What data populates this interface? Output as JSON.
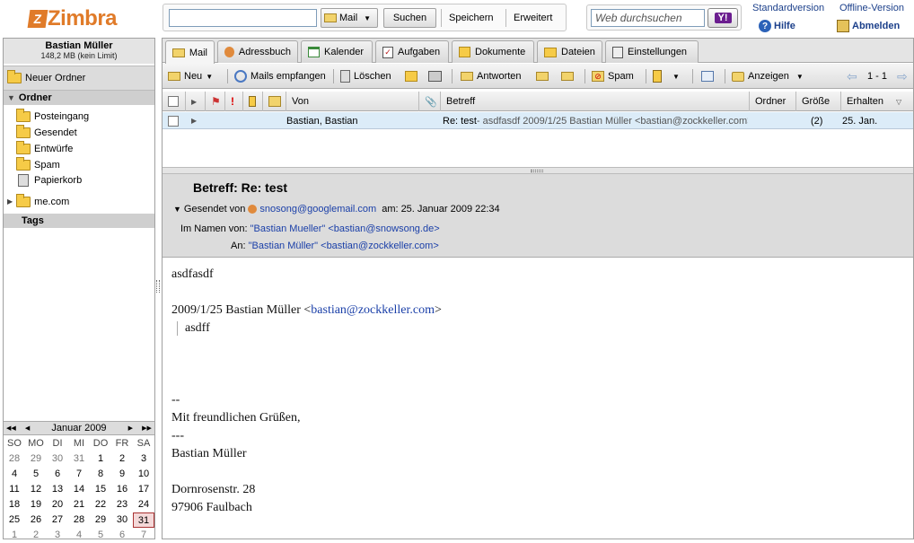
{
  "header": {
    "logo_text": "Zimbra",
    "logo_mark": "Z",
    "search_value": "",
    "search_scope": "Mail",
    "search_btn": "Suchen",
    "save_btn": "Speichern",
    "advanced_btn": "Erweitert",
    "web_search_placeholder": "Web durchsuchen",
    "yahoo_label": "Y!",
    "standard_version": "Standardversion",
    "offline_version": "Offline-Version",
    "help": "Hilfe",
    "logout": "Abmelden"
  },
  "sidebar": {
    "user_name": "Bastian Müller",
    "quota": "148,2 MB (kein Limit)",
    "new_folder": "Neuer Ordner",
    "folders_header": "Ordner",
    "folders": [
      {
        "label": "Posteingang"
      },
      {
        "label": "Gesendet"
      },
      {
        "label": "Entwürfe"
      },
      {
        "label": "Spam"
      },
      {
        "label": "Papierkorb"
      },
      {
        "label": "me.com"
      }
    ],
    "tags_header": "Tags"
  },
  "calendar": {
    "month": "Januar 2009",
    "nav_prev_year": "◀◀",
    "nav_prev": "◀",
    "nav_next": "▶",
    "nav_next_year": "▶▶",
    "weekdays": [
      "SO",
      "MO",
      "DI",
      "MI",
      "DO",
      "FR",
      "SA"
    ],
    "weeks": [
      [
        "28",
        "29",
        "30",
        "31",
        "1",
        "2",
        "3"
      ],
      [
        "4",
        "5",
        "6",
        "7",
        "8",
        "9",
        "10"
      ],
      [
        "11",
        "12",
        "13",
        "14",
        "15",
        "16",
        "17"
      ],
      [
        "18",
        "19",
        "20",
        "21",
        "22",
        "23",
        "24"
      ],
      [
        "25",
        "26",
        "27",
        "28",
        "29",
        "30",
        "31"
      ],
      [
        "1",
        "2",
        "3",
        "4",
        "5",
        "6",
        "7"
      ]
    ]
  },
  "tabs": [
    "Mail",
    "Adressbuch",
    "Kalender",
    "Aufgaben",
    "Dokumente",
    "Dateien",
    "Einstellungen"
  ],
  "toolbar": {
    "new": "Neu",
    "receive": "Mails empfangen",
    "delete": "Löschen",
    "reply": "Antworten",
    "spam": "Spam",
    "view": "Anzeigen",
    "paging": "1 - 1"
  },
  "list": {
    "columns": {
      "from": "Von",
      "subject": "Betreff",
      "folder": "Ordner",
      "size": "Größe",
      "received": "Erhalten"
    },
    "rows": [
      {
        "from": "Bastian, Bastian",
        "subject": "Re: test",
        "fragment": " - asdfasdf 2009/1/25 Bastian Müller <bastian@zockkeller.com>",
        "size": "(2)",
        "received": "25. Jan."
      }
    ]
  },
  "message": {
    "subject_label": "Betreff:",
    "subject": "Re: test",
    "sent_by_label": "Gesendet von",
    "sent_by": "snosong@googlemail.com",
    "date_label": "am:",
    "date": "25. Januar 2009 22:34",
    "on_behalf_label": "Im Namen von:",
    "on_behalf": "\"Bastian Mueller\" <bastian@snowsong.de>",
    "to_label": "An:",
    "to": "\"Bastian Müller\" <bastian@zockkeller.com>",
    "body": {
      "line1": "asdfasdf",
      "quote_intro_prefix": "2009/1/25 Bastian Müller <",
      "quote_email": "bastian@zockkeller.com",
      "quote_intro_suffix": ">",
      "quote": "asdff",
      "sig_sep": "--",
      "greeting": "Mit freundlichen Grüßen,",
      "sep2": "---",
      "name": "Bastian Müller",
      "street": "Dornrosenstr. 28",
      "city": "97906 Faulbach"
    }
  }
}
